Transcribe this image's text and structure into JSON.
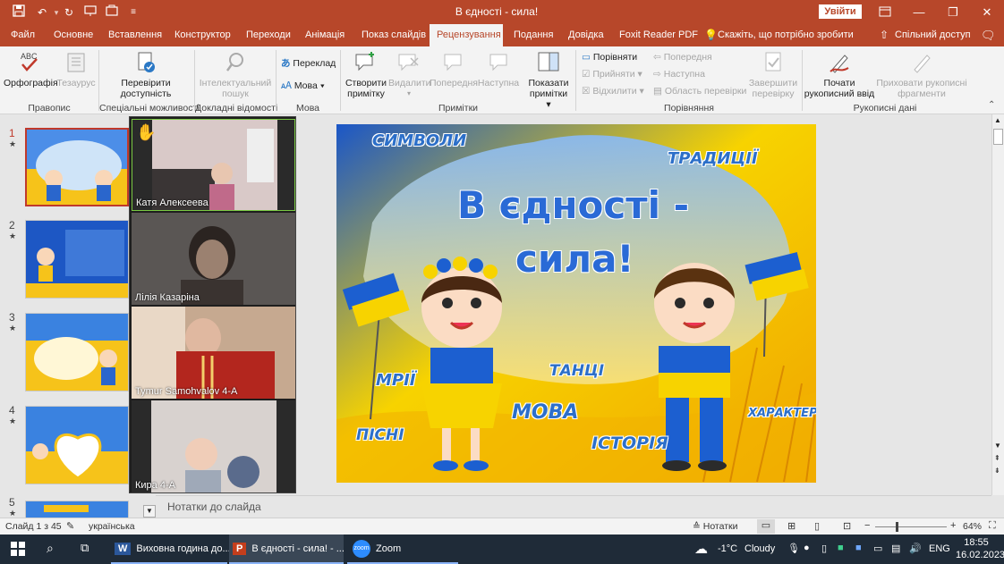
{
  "titlebar": {
    "title": "В єдності - сила!",
    "signin_label": "Увійти"
  },
  "tabs": [
    {
      "label": "Файл"
    },
    {
      "label": "Основне"
    },
    {
      "label": "Вставлення"
    },
    {
      "label": "Конструктор"
    },
    {
      "label": "Переходи"
    },
    {
      "label": "Анімація"
    },
    {
      "label": "Показ слайдів"
    },
    {
      "label": "Рецензування"
    },
    {
      "label": "Подання"
    },
    {
      "label": "Довідка"
    },
    {
      "label": "Foxit Reader PDF"
    }
  ],
  "tell_me": "Скажіть, що потрібно зробити",
  "share_label": "Спільний доступ",
  "ribbon": {
    "spelling": "Орфографія",
    "thesaurus": "Тезаурус",
    "grp_proofing": "Правопис",
    "check_access_1": "Перевірити",
    "check_access_2": "доступність",
    "grp_access": "Спеціальні можливості",
    "smart_lookup_1": "Інтелектуальний",
    "smart_lookup_2": "пошук",
    "grp_insights": "Докладні відомості",
    "translate": "Переклад",
    "language": "Мова",
    "grp_language": "Мова",
    "new_comment_1": "Створити",
    "new_comment_2": "примітку",
    "delete": "Видалити",
    "previous": "Попередня",
    "next": "Наступна",
    "show_comments_1": "Показати",
    "show_comments_2": "примітки",
    "grp_comments": "Примітки",
    "compare": "Порівняти",
    "accept": "Прийняти",
    "reject": "Відхилити",
    "cmp_previous": "Попередня",
    "cmp_next": "Наступна",
    "reviewing_pane": "Область перевірки",
    "end_review_1": "Завершити",
    "end_review_2": "перевірку",
    "grp_compare": "Порівняння",
    "start_ink_1": "Почати",
    "start_ink_2": "рукописний ввід",
    "hide_ink_1": "Приховати рукописні",
    "hide_ink_2": "фрагменти",
    "grp_ink": "Рукописні дані"
  },
  "thumbnails": [
    {
      "num": "1",
      "star": "★"
    },
    {
      "num": "2",
      "star": "★"
    },
    {
      "num": "3",
      "star": "★"
    },
    {
      "num": "4",
      "star": "★"
    },
    {
      "num": "5",
      "star": "★"
    }
  ],
  "participants": [
    {
      "name": "Катя Алексеева"
    },
    {
      "name": "Лілія Казаріна"
    },
    {
      "name": "Tymur Samohvalov 4-A"
    },
    {
      "name": "Кира 4-А"
    }
  ],
  "slide": {
    "title_line1": "В єдності -",
    "title_line2": "сила!",
    "words": {
      "symbols": "СИМВОЛИ",
      "traditions": "ТРАДИЦІЇ",
      "dreams": "МРІЇ",
      "dances": "ТАНЦІ",
      "language": "МОВА",
      "songs": "ПІСНІ",
      "history": "ІСТОРІЯ",
      "character": "ХАРАКТЕР"
    }
  },
  "notes_label": "Нотатки до слайда",
  "status": {
    "slide_info": "Слайд 1 з 45",
    "language": "українська",
    "notes_btn": "Нотатки",
    "zoom": "64%"
  },
  "taskbar": {
    "app1": "Виховна година до...",
    "app2": "В єдності - сила! - ...",
    "app3": "Zoom",
    "temp": "-1°C",
    "weather": "Cloudy",
    "lang": "ENG",
    "time": "18:55",
    "date": "16.02.2023"
  },
  "colors": {
    "accent": "#b7472a",
    "taskbar": "#1f2b38",
    "flag_blue": "#1c5fd0",
    "flag_yellow": "#f7d300"
  }
}
